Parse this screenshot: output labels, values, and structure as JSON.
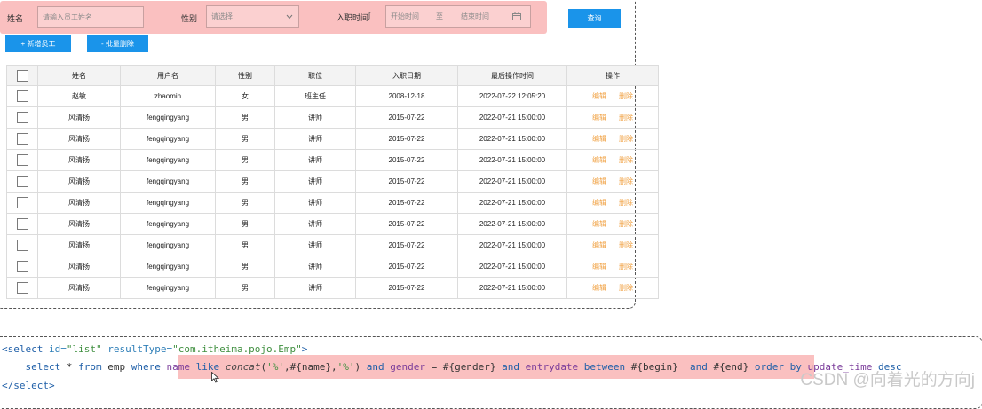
{
  "search": {
    "name_label": "姓名",
    "name_placeholder": "请输入员工姓名",
    "gender_label": "性别",
    "gender_placeholder": "请选择",
    "entry_label": "入职时间",
    "start_placeholder": "开始时间",
    "range_sep": "至",
    "end_placeholder": "结束时间",
    "query_button": "查询"
  },
  "toolbar": {
    "add_button": "+ 新增员工",
    "batch_delete_button": "- 批量删除"
  },
  "table": {
    "headers": [
      "姓名",
      "用户名",
      "性别",
      "职位",
      "入职日期",
      "最后操作时间",
      "操作"
    ],
    "edit_label": "编辑",
    "delete_label": "删除",
    "rows": [
      [
        "赵敏",
        "zhaomin",
        "女",
        "班主任",
        "2008-12-18",
        "2022-07-22 12:05:20"
      ],
      [
        "风清扬",
        "fengqingyang",
        "男",
        "讲师",
        "2015-07-22",
        "2022-07-21 15:00:00"
      ],
      [
        "风清扬",
        "fengqingyang",
        "男",
        "讲师",
        "2015-07-22",
        "2022-07-21 15:00:00"
      ],
      [
        "风清扬",
        "fengqingyang",
        "男",
        "讲师",
        "2015-07-22",
        "2022-07-21 15:00:00"
      ],
      [
        "风清扬",
        "fengqingyang",
        "男",
        "讲师",
        "2015-07-22",
        "2022-07-21 15:00:00"
      ],
      [
        "风清扬",
        "fengqingyang",
        "男",
        "讲师",
        "2015-07-22",
        "2022-07-21 15:00:00"
      ],
      [
        "风清扬",
        "fengqingyang",
        "男",
        "讲师",
        "2015-07-22",
        "2022-07-21 15:00:00"
      ],
      [
        "风清扬",
        "fengqingyang",
        "男",
        "讲师",
        "2015-07-22",
        "2022-07-21 15:00:00"
      ],
      [
        "风清扬",
        "fengqingyang",
        "男",
        "讲师",
        "2015-07-22",
        "2022-07-21 15:00:00"
      ],
      [
        "风清扬",
        "fengqingyang",
        "男",
        "讲师",
        "2015-07-22",
        "2022-07-21 15:00:00"
      ]
    ]
  },
  "code": {
    "line1": {
      "open": "<select",
      "id_attr": " id=",
      "id_val": "\"list\"",
      "rt_attr": " resultType=",
      "rt_val": "\"com.itheima.pojo.Emp\"",
      "close": ">"
    },
    "line2": {
      "indent": "    ",
      "select_kw": "select",
      "star": " * ",
      "from_kw": "from",
      "table": " emp ",
      "where_kw": "where",
      "space": " ",
      "name_col": "name",
      "like_kw": " like ",
      "concat_fn": "concat",
      "concat_args_a": "(",
      "concat_str1": "'%'",
      "concat_mid": ",#{name},",
      "concat_str2": "'%'",
      "concat_args_b": ")",
      "and1": " and ",
      "gender_col": "gender",
      "eq": " = #{gender} ",
      "and2": "and ",
      "entry_col": "entrydate",
      "between_kw": " between ",
      "begin": "#{begin} ",
      "and3": " and ",
      "end": "#{end}",
      "order_kw": " order by ",
      "order_col": "update_time",
      "desc_kw": " desc"
    },
    "line3": "</select>"
  },
  "watermark": "CSDN @向着光的方向j"
}
